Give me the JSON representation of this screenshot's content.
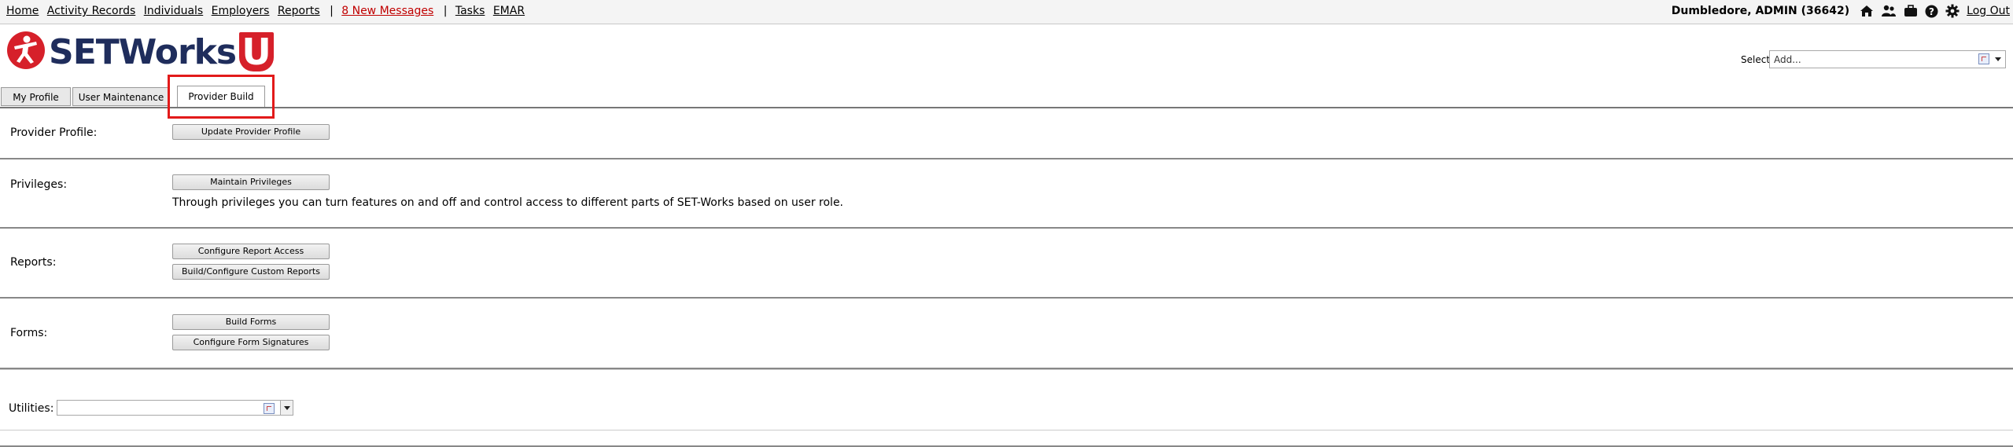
{
  "nav": {
    "links": [
      "Home",
      "Activity Records",
      "Individuals",
      "Employers",
      "Reports"
    ],
    "separator": "|",
    "messages": "8 New Messages",
    "links2": [
      "Tasks",
      "EMAR"
    ]
  },
  "user": {
    "name": "Dumbledore, ADMIN (36642)",
    "logout": "Log Out"
  },
  "logo": {
    "text": "SETWorks",
    "badge": "U"
  },
  "select": {
    "label": "Select:",
    "value": "Add..."
  },
  "tabs": [
    {
      "label": "My Profile"
    },
    {
      "label": "User Maintenance"
    },
    {
      "label": "Provider Build"
    }
  ],
  "sections": {
    "profile": {
      "label": "Provider Profile:",
      "buttons": [
        "Update Provider Profile"
      ]
    },
    "privileges": {
      "label": "Privileges:",
      "buttons": [
        "Maintain Privileges"
      ],
      "description": "Through privileges you can turn features on and off and control access to different parts of SET-Works based on user role."
    },
    "reports": {
      "label": "Reports:",
      "buttons": [
        "Configure Report Access",
        "Build/Configure Custom Reports"
      ]
    },
    "forms": {
      "label": "Forms:",
      "buttons": [
        "Build Forms",
        "Configure Form Signatures"
      ]
    },
    "utilities": {
      "label": "Utilities:",
      "value": ""
    }
  },
  "colors": {
    "accent": "#d6202a",
    "brand": "#1f2d5c",
    "link_alert": "#c00000",
    "highlight": "#e21a1a"
  }
}
